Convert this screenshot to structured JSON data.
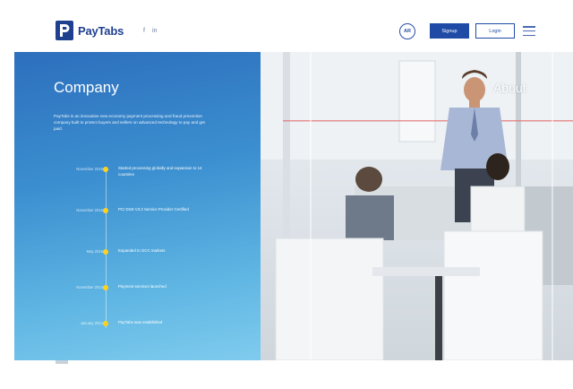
{
  "header": {
    "brand": "PayTabs",
    "social": [
      "f",
      "in"
    ],
    "avatar_label": "AR",
    "signup_label": "Signup",
    "login_label": "Login"
  },
  "panel": {
    "title": "Company",
    "description": "PayTabs is an innovative new economy payment processing and fraud prevention company built to protect buyers and sellers on advanced technology to pay and get paid.",
    "timeline": [
      {
        "date": "November 2016",
        "text": "Started processing globally and expansion to 14 countries"
      },
      {
        "date": "November 2015",
        "text": "PCI DSS V3.2 Service Provider Certified"
      },
      {
        "date": "May 2015",
        "text": "Expanded to GCC markets"
      },
      {
        "date": "November 2014",
        "text": "Payment services launched"
      },
      {
        "date": "January 2014",
        "text": "PayTabs was established"
      }
    ]
  },
  "about_label": "About",
  "colors": {
    "brand": "#1f4aa6",
    "panel_top": "#2d6fbd",
    "panel_bottom": "#7fcbee",
    "timeline_dot": "#ffd21e"
  }
}
